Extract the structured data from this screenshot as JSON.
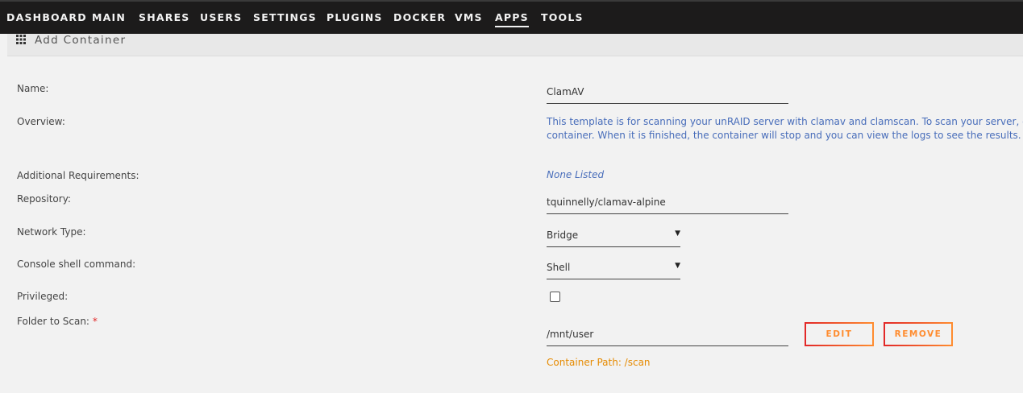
{
  "nav": {
    "items": [
      "DASHBOARD",
      "MAIN",
      "SHARES",
      "USERS",
      "SETTINGS",
      "PLUGINS",
      "DOCKER",
      "VMS",
      "APPS",
      "TOOLS"
    ],
    "active": "APPS"
  },
  "page": {
    "title": "Add Container",
    "icon": "grid-icon"
  },
  "form": {
    "name_label": "Name:",
    "name_value": "ClamAV",
    "overview_label": "Overview:",
    "overview_text": "This template is for scanning your unRAID server with clamav and clamscan. To scan your server, cl container. When it is finished, the container will stop and you can view the logs to see the results.",
    "overview_line1": "This template is for scanning your unRAID server with clamav and clamscan. To scan your server, cl",
    "overview_line2": "container. When it is finished, the container will stop and you can view the logs to see the results.",
    "requirements_label": "Additional Requirements:",
    "requirements_value": "None Listed",
    "repository_label": "Repository:",
    "repository_value": "tquinnelly/clamav-alpine",
    "network_label": "Network Type:",
    "network_value": "Bridge",
    "console_label": "Console shell command:",
    "console_value": "Shell",
    "privileged_label": "Privileged:",
    "privileged_checked": false,
    "folder_label": "Folder to Scan:",
    "folder_required_mark": "*",
    "folder_value": "/mnt/user",
    "edit_label": "EDIT",
    "remove_label": "REMOVE",
    "container_path": "Container Path: /scan"
  },
  "colors": {
    "topbar": "#1c1b1b",
    "background": "#f2f2f2",
    "link_blue": "#486dba",
    "orange": "#ff8c2f",
    "red": "#e22828"
  }
}
